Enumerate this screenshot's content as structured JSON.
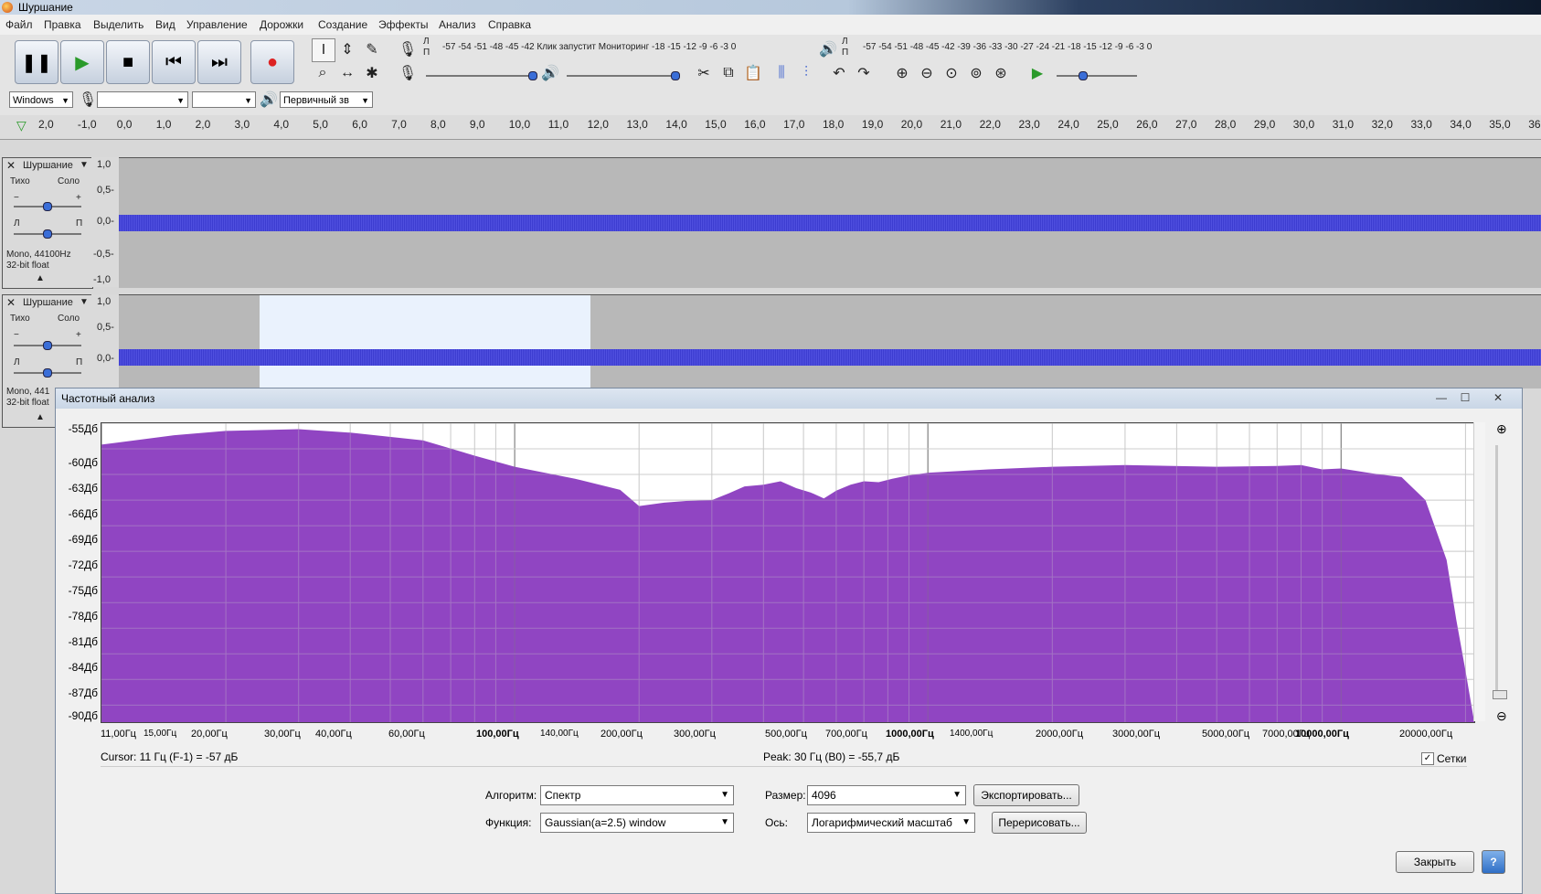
{
  "window": {
    "title": "Шуршание"
  },
  "menu": [
    "Файл",
    "Правка",
    "Выделить",
    "Вид",
    "Управление",
    "Дорожки",
    "Создание",
    "Эффекты",
    "Анализ",
    "Справка"
  ],
  "meters": {
    "record_scale": "-57 -54 -51 -48 -45 -42 Клик запустит Мониторинг -18 -15 -12  -9  -6  -3  0",
    "play_scale": "-57 -54 -51 -48 -45 -42 -39 -36 -33 -30 -27 -24 -21 -18 -15 -12  -9  -6  -3  0",
    "lp_top": "Л",
    "lp_bottom": "П"
  },
  "device": {
    "host": "Windows",
    "channels": "Первичный зв"
  },
  "ruler": [
    "2,0",
    "-1,0",
    "0,0",
    "1,0",
    "2,0",
    "3,0",
    "4,0",
    "5,0",
    "6,0",
    "7,0",
    "8,0",
    "9,0",
    "10,0",
    "11,0",
    "12,0",
    "13,0",
    "14,0",
    "15,0",
    "16,0",
    "17,0",
    "18,0",
    "19,0",
    "20,0",
    "21,0",
    "22,0",
    "23,0",
    "24,0",
    "25,0",
    "26,0",
    "27,0",
    "28,0",
    "29,0",
    "30,0",
    "31,0",
    "32,0",
    "33,0",
    "34,0",
    "35,0",
    "36,0"
  ],
  "tracks": [
    {
      "name": "Шуршание",
      "mute": "Тихо",
      "solo": "Соло",
      "minus": "−",
      "plus": "+",
      "pan_l": "Л",
      "pan_r": "П",
      "info1": "Mono, 44100Hz",
      "info2": "32-bit float",
      "yaxis": [
        "1,0",
        "0,5-",
        "0,0-",
        "-0,5-",
        "-1,0"
      ]
    },
    {
      "name": "Шуршание",
      "mute": "Тихо",
      "solo": "Соло",
      "minus": "−",
      "plus": "+",
      "pan_l": "Л",
      "pan_r": "П",
      "info1": "Mono, 441",
      "info2": "32-bit float",
      "yaxis": [
        "1,0",
        "0,5-",
        "0,0-"
      ]
    }
  ],
  "dialog": {
    "title": "Частотный анализ",
    "y_labels": [
      "-55Дб",
      "-60Дб",
      "-63Дб",
      "-66Дб",
      "-69Дб",
      "-72Дб",
      "-75Дб",
      "-78Дб",
      "-81Дб",
      "-84Дб",
      "-87Дб",
      "-90Дб"
    ],
    "x_labels": [
      "11,00Гц",
      "15,00Гц",
      "20,00Гц",
      "30,00Гц",
      "40,00Гц",
      "60,00Гц",
      "100,00Гц",
      "140,00Гц",
      "200,00Гц",
      "300,00Гц",
      "500,00Гц",
      "700,00Гц",
      "1000,00Гц",
      "1400,00Гц",
      "2000,00Гц",
      "3000,00Гц",
      "5000,00Гц",
      "7000,00Гц",
      "10000,00Гц",
      "20000,00Гц"
    ],
    "cursor": "Cursor: 11 Гц (F-1) = -57 дБ",
    "peak": "Peak: 30 Гц (B0) = -55,7 дБ",
    "grid_label": "Сетки",
    "grid_checked": true,
    "algorithm_label": "Алгоритм:",
    "algorithm": "Спектр",
    "size_label": "Размер:",
    "size": "4096",
    "export": "Экспортировать...",
    "function_label": "Функция:",
    "function": "Gaussian(a=2.5) window",
    "axis_label": "Ось:",
    "axis": "Логарифмический масштаб",
    "redraw": "Перерисовать...",
    "close": "Закрыть",
    "help": "?"
  },
  "spectrum": {
    "freq_hz": [
      10,
      15,
      20,
      30,
      40,
      60,
      80,
      100,
      140,
      180,
      200,
      230,
      260,
      300,
      330,
      360,
      400,
      440,
      480,
      520,
      560,
      600,
      650,
      700,
      760,
      820,
      900,
      1000,
      1400,
      2000,
      3000,
      5000,
      7000,
      8000,
      9000,
      10000,
      12000,
      14000,
      16000,
      18000,
      19000,
      20000,
      21000
    ],
    "db": [
      -57.5,
      -56.4,
      -55.9,
      -55.7,
      -56.1,
      -57.0,
      -58.8,
      -60.1,
      -61.5,
      -62.8,
      -64.7,
      -64.3,
      -64.1,
      -64.0,
      -63.2,
      -62.4,
      -62.2,
      -61.8,
      -62.6,
      -63.1,
      -63.8,
      -62.9,
      -62.2,
      -61.8,
      -61.9,
      -61.5,
      -61.1,
      -60.8,
      -60.4,
      -60.1,
      -59.9,
      -60.1,
      -60.0,
      -59.9,
      -60.4,
      -60.3,
      -60.9,
      -61.3,
      -64.0,
      -71.0,
      -78.0,
      -84.0,
      -90.0
    ],
    "y_min": -90,
    "y_max": -55,
    "x_min": 10,
    "x_max": 21000
  }
}
